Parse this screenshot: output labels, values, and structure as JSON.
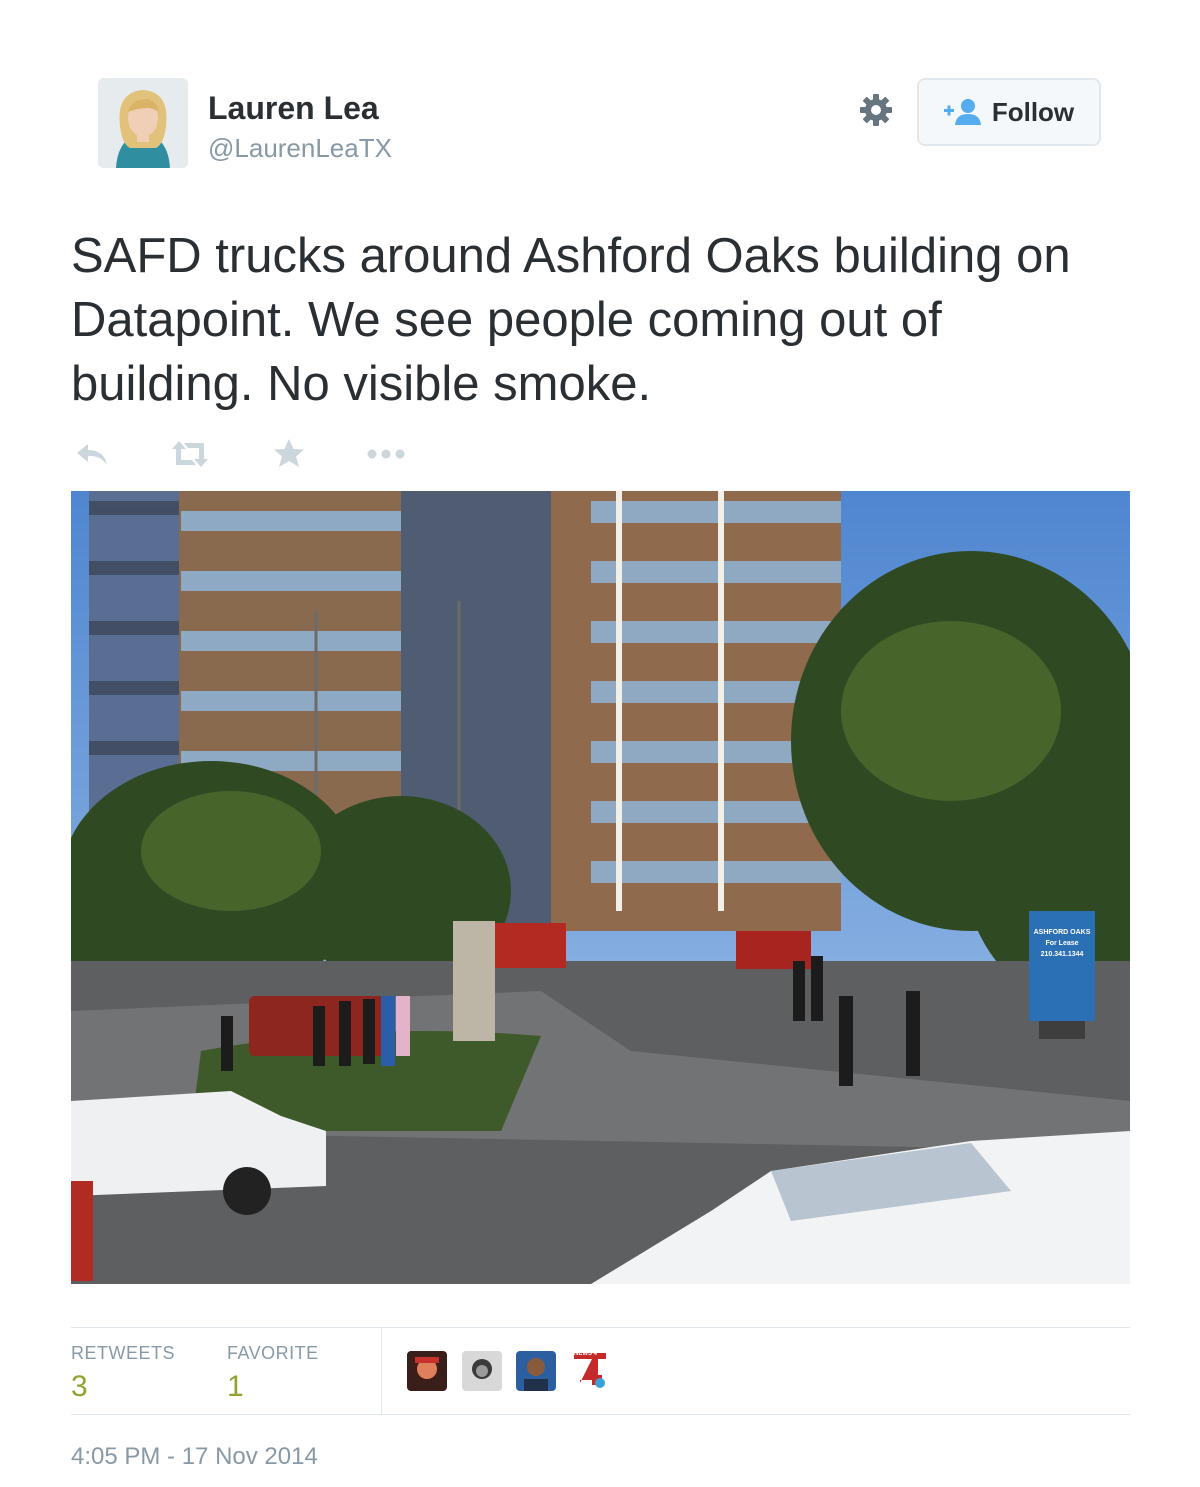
{
  "user": {
    "name": "Lauren Lea",
    "handle": "@LaurenLeaTX"
  },
  "header": {
    "follow_label": "Follow",
    "follow_icon": "add-user-icon",
    "settings_icon": "gear-icon"
  },
  "tweet": {
    "text": "SAFD trucks around Ashford Oaks building on Datapoint. We see people coming out of building. No visible smoke.",
    "actions": [
      "reply-icon",
      "retweet-icon",
      "favorite-star-icon",
      "more-icon"
    ],
    "photo": {
      "sign_lines": [
        "ASHFORD OAKS",
        "For Lease",
        "210.341.1344"
      ]
    }
  },
  "stats": {
    "retweets_label": "RETWEETS",
    "retweets_count": "3",
    "favorites_label": "FAVORITE",
    "favorites_count": "1",
    "favoriter_badge": "NEWS 4"
  },
  "timestamp": "4:05 PM - 17 Nov 2014",
  "colors": {
    "text": "#292f33",
    "muted": "#8899a6",
    "count": "#8fa332",
    "border": "#e1e8ed",
    "follow_icon": "#55acee"
  }
}
